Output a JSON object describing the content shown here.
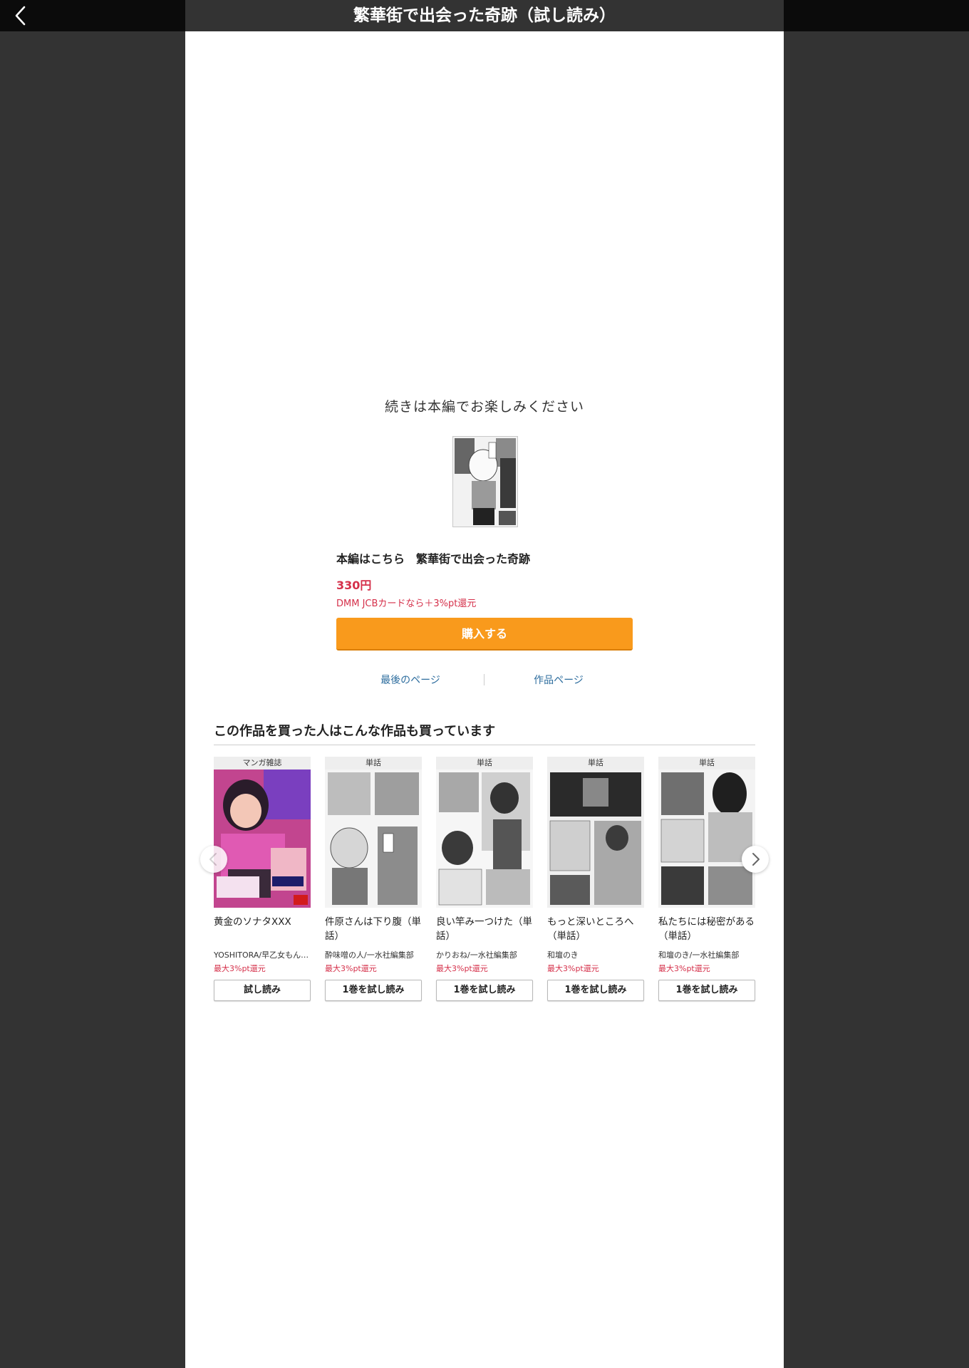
{
  "header": {
    "title": "繁華街で出会った奇跡（試し読み）",
    "back_icon": "chevron-left-icon"
  },
  "end": {
    "continue_text": "続きは本編でお楽しみください",
    "main_label": "本編はこちら　繁華街で出会った奇跡",
    "price": "330円",
    "campaign": "DMM JCBカードなら＋3%pt還元",
    "buy_label": "購入する",
    "last_page_link": "最後のページ",
    "work_page_link": "作品ページ"
  },
  "recommend": {
    "title": "この作品を買った人はこんな作品も買っています",
    "items": [
      {
        "category": "マンガ雑誌",
        "name": "黄金のソナタXXX",
        "author": "YOSHITORA/早乙女もん…",
        "points": "最大3%pt還元",
        "button": "試し読み"
      },
      {
        "category": "単話",
        "name": "件原さんは下り腹（単話）",
        "author": "酔味噌の人/一水社編集部",
        "points": "最大3%pt還元",
        "button": "1巻を試し読み"
      },
      {
        "category": "単話",
        "name": "良い竿み一つけた（単話）",
        "author": "かりおね/一水社編集部",
        "points": "最大3%pt還元",
        "button": "1巻を試し読み"
      },
      {
        "category": "単話",
        "name": "もっと深いところへ（単話）",
        "author": "和壇のき",
        "points": "最大3%pt還元",
        "button": "1巻を試し読み"
      },
      {
        "category": "単話",
        "name": "私たちには秘密がある（単話）",
        "author": "和壇のき/一水社編集部",
        "points": "最大3%pt還元",
        "button": "1巻を試し読み"
      }
    ]
  },
  "colors": {
    "accent": "#f99a1c",
    "price_red": "#d5304a",
    "link_blue": "#2d6d9e",
    "backdrop": "#333333"
  }
}
